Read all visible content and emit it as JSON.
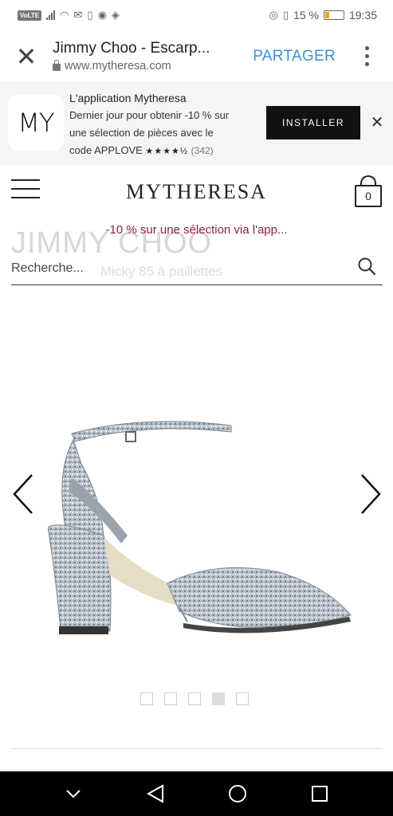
{
  "status_bar": {
    "volte": "VoLTE",
    "battery_percent": "15 %",
    "time": "19:35",
    "icons": [
      "signal-icon",
      "wifi-icon",
      "mail-icon",
      "download-icon",
      "app-icon",
      "vpn-icon",
      "eye-icon",
      "vibrate-icon",
      "battery-icon"
    ]
  },
  "browser": {
    "title": "Jimmy Choo - Escarp...",
    "url": "www.mytheresa.com",
    "share_label": "PARTAGER"
  },
  "app_banner": {
    "logo_text": "MY",
    "app_name": "L'application Mytheresa",
    "line1": "Dernier jour pour obtenir -10 % sur",
    "line2": "une sélection de pièces avec le",
    "line3_prefix": "code APPLOVE",
    "stars": "★★★★½",
    "rating_count": "(342)",
    "install_label": "INSTALLER"
  },
  "header": {
    "brand": "MYTHERESA",
    "bag_count": "0"
  },
  "promo": {
    "text": "-10 % sur une sélection via l'app..."
  },
  "product": {
    "brand_ghost": "JIMMY CHOO",
    "name_ghost": "Micky 85 à paillettes",
    "image_count": 5,
    "active_image": 4
  },
  "search": {
    "placeholder": "Recherche..."
  },
  "colors": {
    "promo": "#8a2140",
    "share": "#3b8fd8",
    "install_bg": "#111111",
    "battery": "#e5a50a"
  }
}
